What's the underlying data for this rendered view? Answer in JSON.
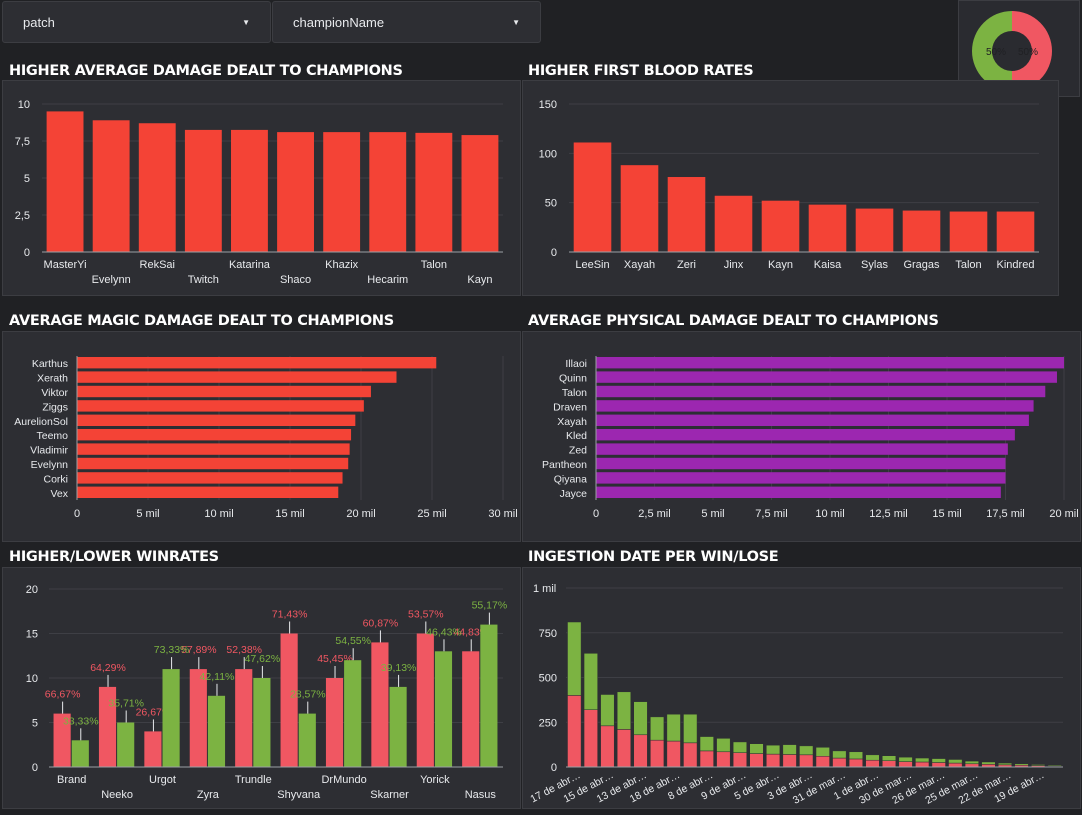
{
  "filters": [
    {
      "label": "patch"
    },
    {
      "label": "championName"
    }
  ],
  "donut": {
    "slices": [
      {
        "label": "50%",
        "value": 50,
        "color": "#7cb342"
      },
      {
        "label": "50%",
        "value": 50,
        "color": "#f05762"
      }
    ]
  },
  "titles": {
    "avg_damage": "HIGHER AVERAGE DAMAGE DEALT TO CHAMPIONS",
    "first_blood": "HIGHER FIRST BLOOD RATES",
    "magic": "AVERAGE MAGIC DAMAGE DEALT TO CHAMPIONS",
    "physical": "AVERAGE PHYSICAL DAMAGE DEALT TO CHAMPIONS",
    "winrates": "HIGHER/LOWER WINRATES",
    "ingestion": "INGESTION DATE PER WIN/LOSE"
  },
  "chart_data": [
    {
      "id": "avg_damage",
      "type": "bar",
      "categories": [
        "MasterYi",
        "Evelynn",
        "RekSai",
        "Twitch",
        "Katarina",
        "Shaco",
        "Khazix",
        "Hecarim",
        "Talon",
        "Kayn"
      ],
      "values": [
        9.5,
        8.9,
        8.7,
        8.25,
        8.25,
        8.1,
        8.1,
        8.1,
        8.05,
        7.9
      ],
      "yticks": [
        "0",
        "2,5",
        "5",
        "7,5",
        "10"
      ],
      "ylim": [
        0,
        10
      ],
      "color": "#f44336"
    },
    {
      "id": "first_blood",
      "type": "bar",
      "categories": [
        "LeeSin",
        "Xayah",
        "Zeri",
        "Jinx",
        "Kayn",
        "Kaisa",
        "Sylas",
        "Gragas",
        "Talon",
        "Kindred"
      ],
      "values": [
        111,
        88,
        76,
        57,
        52,
        48,
        44,
        42,
        41,
        41
      ],
      "yticks": [
        "0",
        "50",
        "100",
        "150"
      ],
      "ylim": [
        0,
        150
      ],
      "color": "#f44336"
    },
    {
      "id": "magic",
      "type": "bar",
      "orientation": "horizontal",
      "categories": [
        "Karthus",
        "Xerath",
        "Viktor",
        "Ziggs",
        "AurelionSol",
        "Teemo",
        "Vladimir",
        "Evelynn",
        "Corki",
        "Vex"
      ],
      "values": [
        25300,
        22500,
        20700,
        20200,
        19600,
        19300,
        19200,
        19100,
        18700,
        18400
      ],
      "xticks": [
        "0",
        "5 mil",
        "10 mil",
        "15 mil",
        "20 mil",
        "25 mil",
        "30 mil"
      ],
      "xlim": [
        0,
        30000
      ],
      "color": "#f44336"
    },
    {
      "id": "physical",
      "type": "bar",
      "orientation": "horizontal",
      "categories": [
        "Illaoi",
        "Quinn",
        "Talon",
        "Draven",
        "Xayah",
        "Kled",
        "Zed",
        "Pantheon",
        "Qiyana",
        "Jayce"
      ],
      "values": [
        20000,
        19700,
        19200,
        18700,
        18500,
        17900,
        17600,
        17500,
        17500,
        17300
      ],
      "xticks": [
        "0",
        "2,5 mil",
        "5 mil",
        "7,5 mil",
        "10 mil",
        "12,5 mil",
        "15 mil",
        "17,5 mil",
        "20 mil"
      ],
      "xlim": [
        0,
        20000
      ],
      "color": "#9c27b0"
    },
    {
      "id": "winrates",
      "type": "bar",
      "categories": [
        "Brand",
        "Neeko",
        "Urgot",
        "Zyra",
        "Trundle",
        "Shyvana",
        "DrMundo",
        "Skarner",
        "Yorick",
        "Nasus"
      ],
      "series": [
        {
          "values": [
            6,
            9,
            4,
            11,
            11,
            15,
            10,
            14,
            15,
            13
          ],
          "labels": [
            "66,67%",
            "64,29%",
            "26,67%",
            "57,89%",
            "52,38%",
            "71,43%",
            "45,45%",
            "60,87%",
            "53,57%",
            "44,83%"
          ],
          "color": "#f05762"
        },
        {
          "values": [
            3,
            5,
            11,
            8,
            10,
            6,
            12,
            9,
            13,
            16
          ],
          "labels": [
            "33,33%",
            "35,71%",
            "73,33%",
            "42,11%",
            "47,62%",
            "28,57%",
            "54,55%",
            "39,13%",
            "46,43%",
            "55,17%"
          ],
          "color": "#7cb342"
        }
      ],
      "yticks": [
        "0",
        "5",
        "10",
        "15",
        "20"
      ],
      "ylim": [
        0,
        20
      ]
    },
    {
      "id": "ingestion",
      "type": "bar",
      "stacked": true,
      "categories": [
        "17 de abr…",
        "",
        "15 de abr…",
        "",
        "13 de abr…",
        "",
        "18 de abr…",
        "",
        "8 de abr…",
        "",
        "9 de abr…",
        "",
        "5 de abr…",
        "",
        "3 de abr…",
        "",
        "31 de mar…",
        "",
        "1 de abr…",
        "",
        "30 de mar…",
        "",
        "26 de mar…",
        "",
        "25 de mar…",
        "",
        "22 de mar…",
        "",
        "19 de abr…",
        ""
      ],
      "series": [
        {
          "values": [
            400,
            320,
            230,
            210,
            180,
            150,
            145,
            135,
            90,
            85,
            80,
            75,
            72,
            70,
            68,
            60,
            50,
            45,
            38,
            35,
            30,
            28,
            25,
            22,
            18,
            15,
            12,
            10,
            8,
            5
          ],
          "color": "#f05762"
        },
        {
          "values": [
            410,
            315,
            175,
            210,
            185,
            130,
            150,
            160,
            80,
            75,
            60,
            55,
            50,
            55,
            50,
            50,
            40,
            40,
            30,
            28,
            25,
            22,
            22,
            20,
            15,
            13,
            10,
            8,
            6,
            5
          ],
          "color": "#7cb342"
        }
      ],
      "yticks": [
        "0",
        "250",
        "500",
        "750",
        "1 mil"
      ],
      "ylim": [
        0,
        1000
      ]
    }
  ]
}
